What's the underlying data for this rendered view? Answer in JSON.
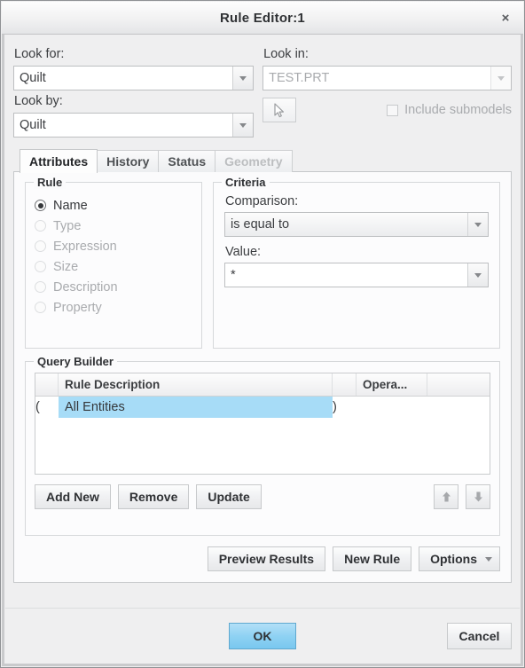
{
  "window": {
    "title": "Rule Editor:1",
    "close_label": "×"
  },
  "search": {
    "look_for_label": "Look for:",
    "look_for_value": "Quilt",
    "look_by_label": "Look by:",
    "look_by_value": "Quilt",
    "look_in_label": "Look in:",
    "look_in_value": "TEST.PRT",
    "include_submodels_label": "Include submodels",
    "include_submodels_checked": false
  },
  "tabs": [
    {
      "label": "Attributes",
      "state": "active"
    },
    {
      "label": "History",
      "state": "enabled"
    },
    {
      "label": "Status",
      "state": "enabled"
    },
    {
      "label": "Geometry",
      "state": "disabled"
    }
  ],
  "rule": {
    "legend": "Rule",
    "options": [
      {
        "label": "Name",
        "selected": true,
        "disabled": false
      },
      {
        "label": "Type",
        "selected": false,
        "disabled": true
      },
      {
        "label": "Expression",
        "selected": false,
        "disabled": true
      },
      {
        "label": "Size",
        "selected": false,
        "disabled": true
      },
      {
        "label": "Description",
        "selected": false,
        "disabled": true
      },
      {
        "label": "Property",
        "selected": false,
        "disabled": true
      }
    ]
  },
  "criteria": {
    "legend": "Criteria",
    "comparison_label": "Comparison:",
    "comparison_value": "is equal to",
    "value_label": "Value:",
    "value_value": "*"
  },
  "query_builder": {
    "legend": "Query Builder",
    "columns": [
      "",
      "Rule Description",
      "",
      "Opera...",
      ""
    ],
    "rows": [
      {
        "open_paren": "(",
        "description": "All Entities",
        "close_paren": ")",
        "operator": "",
        "extra": "",
        "selected": true
      }
    ],
    "buttons": {
      "add_new": "Add New",
      "remove": "Remove",
      "update": "Update",
      "move_up": "⬆",
      "move_down": "⬇"
    }
  },
  "actions": {
    "preview_results": "Preview Results",
    "new_rule": "New Rule",
    "options": "Options"
  },
  "footer": {
    "ok": "OK",
    "cancel": "Cancel"
  },
  "colors": {
    "selection_blue": "#a7dcf7",
    "ok_button_blue": "#8fd2f3",
    "dialog_bg": "#efeff0"
  }
}
